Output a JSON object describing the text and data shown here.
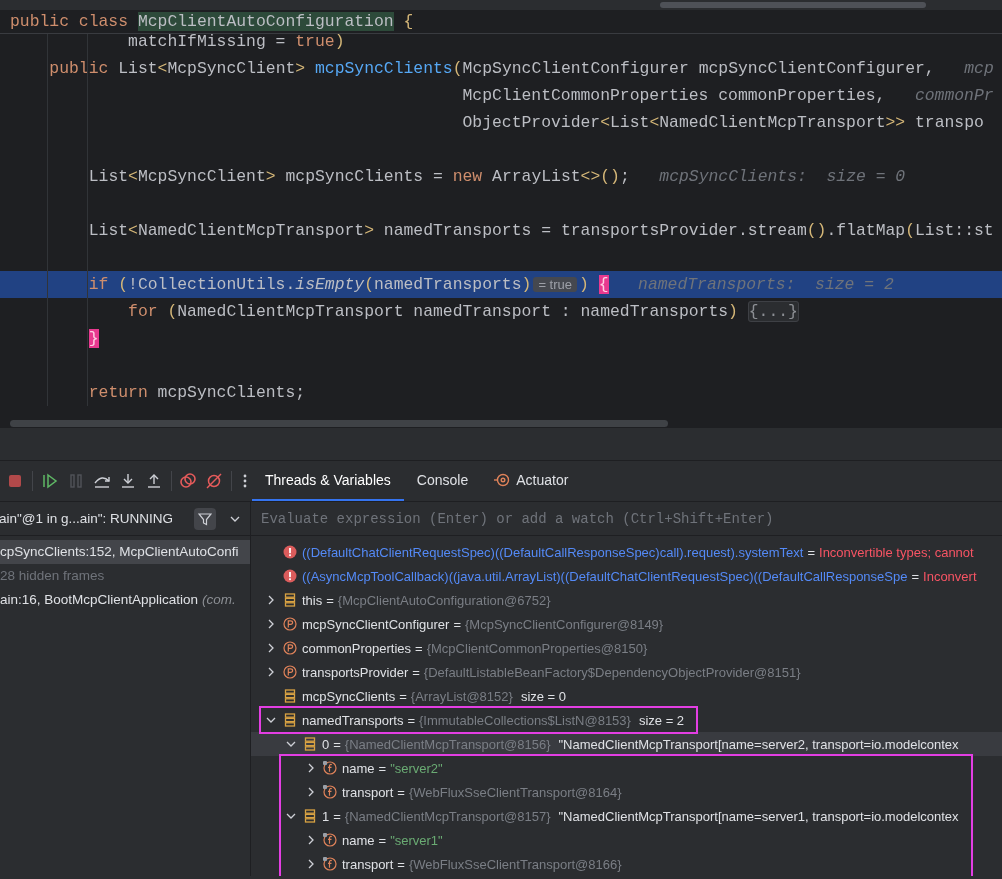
{
  "editor": {
    "sticky_line": [
      {
        "kind": "kw",
        "text": "public class "
      },
      {
        "kind": "match",
        "text": "McpClientAutoConfiguration"
      },
      {
        "kind": "paren",
        "text": " {"
      }
    ],
    "lines": [
      {
        "kind": "code",
        "current": false,
        "segments": [
          {
            "kind": "plain",
            "text": "            matchIfMissing = "
          },
          {
            "kind": "kw",
            "text": "true"
          },
          {
            "kind": "paren",
            "text": ")"
          }
        ]
      },
      {
        "kind": "code",
        "current": false,
        "segments": [
          {
            "kind": "kw",
            "text": "    public"
          },
          {
            "kind": "plain",
            "text": " List"
          },
          {
            "kind": "paren",
            "text": "<"
          },
          {
            "kind": "plain",
            "text": "McpSyncClient"
          },
          {
            "kind": "paren",
            "text": ">"
          },
          {
            "kind": "method",
            "text": " mcpSyncClients"
          },
          {
            "kind": "paren",
            "text": "("
          },
          {
            "kind": "plain",
            "text": "McpSyncClientConfigurer mcpSyncClientConfigurer,"
          },
          {
            "kind": "hint",
            "text": "   mcp"
          }
        ]
      },
      {
        "kind": "code",
        "current": false,
        "segments": [
          {
            "kind": "plain",
            "text": "                                              McpClientCommonProperties commonProperties,"
          },
          {
            "kind": "hint",
            "text": "   commonPr"
          }
        ]
      },
      {
        "kind": "code",
        "current": false,
        "segments": [
          {
            "kind": "plain",
            "text": "                                              ObjectProvider"
          },
          {
            "kind": "paren",
            "text": "<"
          },
          {
            "kind": "plain",
            "text": "List"
          },
          {
            "kind": "paren",
            "text": "<"
          },
          {
            "kind": "plain",
            "text": "NamedClientMcpTransport"
          },
          {
            "kind": "paren",
            "text": ">>"
          },
          {
            "kind": "plain",
            "text": " transpo"
          }
        ]
      },
      {
        "kind": "blank"
      },
      {
        "kind": "code",
        "current": false,
        "segments": [
          {
            "kind": "plain",
            "text": "        List"
          },
          {
            "kind": "paren",
            "text": "<"
          },
          {
            "kind": "plain",
            "text": "McpSyncClient"
          },
          {
            "kind": "paren",
            "text": ">"
          },
          {
            "kind": "plain",
            "text": " mcpSyncClients = "
          },
          {
            "kind": "kw",
            "text": "new"
          },
          {
            "kind": "plain",
            "text": " ArrayList"
          },
          {
            "kind": "paren",
            "text": "<>()"
          },
          {
            "kind": "plain",
            "text": ";"
          },
          {
            "kind": "hint",
            "text": "   mcpSyncClients:  size = 0"
          }
        ]
      },
      {
        "kind": "blank"
      },
      {
        "kind": "code",
        "current": false,
        "segments": [
          {
            "kind": "plain",
            "text": "        List"
          },
          {
            "kind": "paren",
            "text": "<"
          },
          {
            "kind": "plain",
            "text": "NamedClientMcpTransport"
          },
          {
            "kind": "paren",
            "text": ">"
          },
          {
            "kind": "plain",
            "text": " namedTransports = transportsProvider.stream"
          },
          {
            "kind": "paren",
            "text": "()"
          },
          {
            "kind": "plain",
            "text": ".flatMap"
          },
          {
            "kind": "paren",
            "text": "("
          },
          {
            "kind": "plain",
            "text": "List::st"
          }
        ]
      },
      {
        "kind": "blank"
      },
      {
        "kind": "code",
        "current": true,
        "segments": [
          {
            "kind": "kw",
            "text": "        if"
          },
          {
            "kind": "paren",
            "text": " ("
          },
          {
            "kind": "plain",
            "text": "!CollectionUtils."
          },
          {
            "kind": "italic",
            "text": "isEmpty"
          },
          {
            "kind": "paren",
            "text": "("
          },
          {
            "kind": "plain",
            "text": "namedTransports"
          },
          {
            "kind": "paren",
            "text": ")"
          },
          {
            "kind": "badge",
            "text": "= true"
          },
          {
            "kind": "paren",
            "text": ")"
          },
          {
            "kind": "brace",
            "text": " {"
          },
          {
            "kind": "hint",
            "text": "   namedTransports:  size = 2"
          }
        ]
      },
      {
        "kind": "code",
        "current": false,
        "segments": [
          {
            "kind": "kw",
            "text": "            for"
          },
          {
            "kind": "paren",
            "text": " ("
          },
          {
            "kind": "plain",
            "text": "NamedClientMcpTransport namedTransport : namedTransports"
          },
          {
            "kind": "paren",
            "text": ")"
          },
          {
            "kind": "fold",
            "text": " {...}"
          }
        ]
      },
      {
        "kind": "code",
        "current": false,
        "segments": [
          {
            "kind": "brace",
            "text": "        }"
          }
        ]
      },
      {
        "kind": "blank"
      },
      {
        "kind": "code",
        "current": false,
        "segments": [
          {
            "kind": "kw",
            "text": "        return"
          },
          {
            "kind": "plain",
            "text": " mcpSyncClients;"
          }
        ]
      }
    ]
  },
  "debugger": {
    "toolbar": [
      {
        "kind": "stop",
        "disabled": false
      },
      {
        "kind": "resume",
        "disabled": false
      },
      {
        "kind": "pause",
        "disabled": true
      },
      {
        "kind": "step-over",
        "disabled": false
      },
      {
        "kind": "step-into",
        "disabled": false
      },
      {
        "kind": "step-out",
        "disabled": false
      },
      {
        "kind": "breakpoints",
        "disabled": false
      },
      {
        "kind": "mute",
        "disabled": false
      },
      {
        "kind": "more",
        "disabled": false
      }
    ],
    "tabs": [
      {
        "label": "Threads & Variables",
        "selected": true,
        "icon": false
      },
      {
        "label": "Console",
        "selected": false,
        "icon": false
      },
      {
        "label": "Actuator",
        "selected": false,
        "icon": true
      }
    ],
    "thread": "ain\"@1 in g...ain\": RUNNING",
    "frames": [
      {
        "kind": "frame",
        "text": "cpSyncClients:152, McpClientAutoConfi",
        "selected": true
      },
      {
        "kind": "hidden",
        "text": "28 hidden frames",
        "selected": false
      },
      {
        "kind": "frame",
        "text": "ain:16, BootMcpClientApplication",
        "package": "(com.",
        "selected": false
      }
    ],
    "eval_placeholder": "Evaluate expression (Enter) or add a watch (Ctrl+Shift+Enter)",
    "variables": [
      {
        "kind": "error",
        "name": "((DefaultChatClientRequestSpec)((DefaultCallResponseSpec)call).request).systemText",
        "sep": "=",
        "value": "Inconvertible types; cannot",
        "selected": false,
        "outlined": false
      },
      {
        "kind": "error",
        "name": "((AsyncMcpToolCallback)((java.util.ArrayList)((DefaultChatClientRequestSpec)((DefaultCallResponseSpe",
        "sep": "=",
        "value": "Inconvert",
        "selected": false,
        "outlined": false
      },
      {
        "kind": "object",
        "name": "this",
        "sep": "=",
        "value": "{McpClientAutoConfiguration@6752}",
        "expanded": false,
        "selected": false,
        "outlined": false
      },
      {
        "kind": "param",
        "name": "mcpSyncClientConfigurer",
        "sep": "=",
        "value": "{McpSyncClientConfigurer@8149}",
        "expanded": false,
        "selected": false,
        "outlined": false
      },
      {
        "kind": "param",
        "name": "commonProperties",
        "sep": "=",
        "value": "{McpClientCommonProperties@8150}",
        "expanded": false,
        "selected": false,
        "outlined": false
      },
      {
        "kind": "param",
        "name": "transportsProvider",
        "sep": "=",
        "value": "{DefaultListableBeanFactory$DependencyObjectProvider@8151}",
        "expanded": false,
        "selected": false,
        "outlined": false
      },
      {
        "kind": "object",
        "name": "mcpSyncClients",
        "sep": "=",
        "value": "{ArrayList@8152}",
        "extra": "size = 0",
        "selected": false,
        "outlined": false
      },
      {
        "kind": "object",
        "name": "namedTransports",
        "sep": "=",
        "value": "{ImmutableCollections$ListN@8153}",
        "extra": "size = 2",
        "expanded": true,
        "selected": false,
        "outlined": true,
        "children": [
          {
            "kind": "object",
            "name": "0",
            "sep": "=",
            "value": "{NamedClientMcpTransport@8156}",
            "extra": "\"NamedClientMcpTransport[name=server2, transport=io.modelcontex",
            "expanded": true,
            "selected": true,
            "outlined": false,
            "children": [
              {
                "kind": "string",
                "name": "name",
                "sep": "=",
                "value": "\"server2\"",
                "expanded": false,
                "selected": false,
                "outlined": true
              },
              {
                "kind": "field",
                "name": "transport",
                "sep": "=",
                "value": "{WebFluxSseClientTransport@8164}",
                "expanded": false,
                "selected": false,
                "outlined": true
              }
            ]
          },
          {
            "kind": "object",
            "name": "1",
            "sep": "=",
            "value": "{NamedClientMcpTransport@8157}",
            "extra": "\"NamedClientMcpTransport[name=server1, transport=io.modelcontex",
            "expanded": true,
            "selected": false,
            "outlined": true,
            "children": [
              {
                "kind": "string",
                "name": "name",
                "sep": "=",
                "value": "\"server1\"",
                "expanded": false,
                "selected": false,
                "outlined": true
              },
              {
                "kind": "field",
                "name": "transport",
                "sep": "=",
                "value": "{WebFluxSseClientTransport@8166}",
                "expanded": false,
                "selected": false,
                "outlined": true
              }
            ]
          }
        ]
      }
    ]
  }
}
